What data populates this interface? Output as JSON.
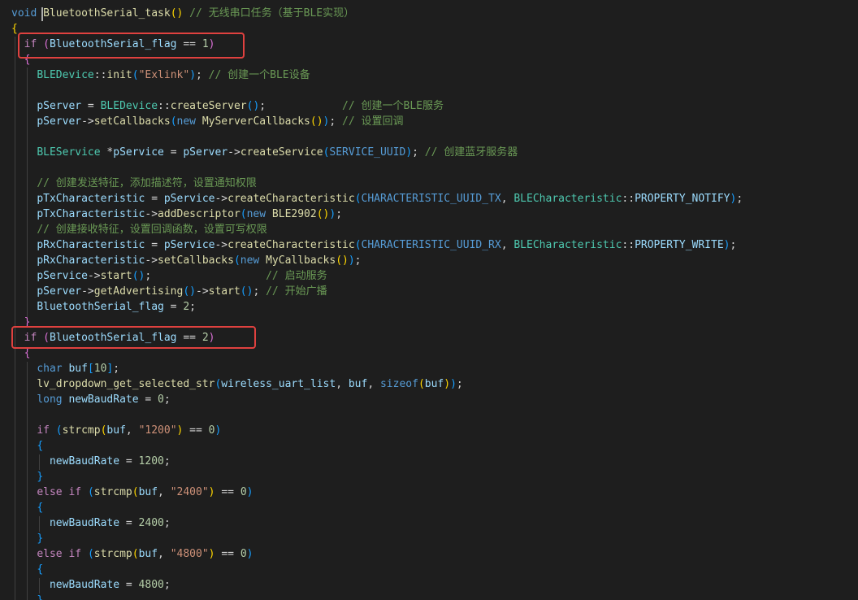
{
  "editor": {
    "lines": [
      [
        {
          "t": "void",
          "c": "kw"
        },
        {
          "t": " ",
          "c": "pl"
        },
        {
          "t": "BluetoothSerial_task",
          "c": "fn"
        },
        {
          "t": "()",
          "c": "br1"
        },
        {
          "t": " // 无线串口任务（基于BLE实现）",
          "c": "cm"
        }
      ],
      [
        {
          "t": "{",
          "c": "br1"
        }
      ],
      [
        {
          "t": "  ",
          "c": "pl"
        },
        {
          "t": "if",
          "c": "ctl"
        },
        {
          "t": " ",
          "c": "pl"
        },
        {
          "t": "(",
          "c": "br2"
        },
        {
          "t": "BluetoothSerial_flag",
          "c": "var"
        },
        {
          "t": " == ",
          "c": "pl"
        },
        {
          "t": "1",
          "c": "num"
        },
        {
          "t": ")",
          "c": "br2"
        }
      ],
      [
        {
          "t": "  ",
          "c": "pl"
        },
        {
          "t": "{",
          "c": "br2"
        }
      ],
      [
        {
          "t": "    ",
          "c": "pl"
        },
        {
          "t": "BLEDevice",
          "c": "ty"
        },
        {
          "t": "::",
          "c": "pl"
        },
        {
          "t": "init",
          "c": "fn"
        },
        {
          "t": "(",
          "c": "br3"
        },
        {
          "t": "\"Exlink\"",
          "c": "str"
        },
        {
          "t": ")",
          "c": "br3"
        },
        {
          "t": "; ",
          "c": "pl"
        },
        {
          "t": "// 创建一个BLE设备",
          "c": "cm"
        }
      ],
      [],
      [
        {
          "t": "    ",
          "c": "pl"
        },
        {
          "t": "pServer",
          "c": "var"
        },
        {
          "t": " = ",
          "c": "pl"
        },
        {
          "t": "BLEDevice",
          "c": "ty"
        },
        {
          "t": "::",
          "c": "pl"
        },
        {
          "t": "createServer",
          "c": "fn"
        },
        {
          "t": "()",
          "c": "br3"
        },
        {
          "t": ";            ",
          "c": "pl"
        },
        {
          "t": "// 创建一个BLE服务",
          "c": "cm"
        }
      ],
      [
        {
          "t": "    ",
          "c": "pl"
        },
        {
          "t": "pServer",
          "c": "var"
        },
        {
          "t": "->",
          "c": "pl"
        },
        {
          "t": "setCallbacks",
          "c": "fn"
        },
        {
          "t": "(",
          "c": "br3"
        },
        {
          "t": "new",
          "c": "kw"
        },
        {
          "t": " ",
          "c": "pl"
        },
        {
          "t": "MyServerCallbacks",
          "c": "fn"
        },
        {
          "t": "()",
          "c": "br1"
        },
        {
          "t": ")",
          "c": "br3"
        },
        {
          "t": "; ",
          "c": "pl"
        },
        {
          "t": "// 设置回调",
          "c": "cm"
        }
      ],
      [],
      [
        {
          "t": "    ",
          "c": "pl"
        },
        {
          "t": "BLEService",
          "c": "ty"
        },
        {
          "t": " *",
          "c": "pl"
        },
        {
          "t": "pService",
          "c": "var"
        },
        {
          "t": " = ",
          "c": "pl"
        },
        {
          "t": "pServer",
          "c": "var"
        },
        {
          "t": "->",
          "c": "pl"
        },
        {
          "t": "createService",
          "c": "fn"
        },
        {
          "t": "(",
          "c": "br3"
        },
        {
          "t": "SERVICE_UUID",
          "c": "ct"
        },
        {
          "t": ")",
          "c": "br3"
        },
        {
          "t": "; ",
          "c": "pl"
        },
        {
          "t": "// 创建蓝牙服务器",
          "c": "cm"
        }
      ],
      [],
      [
        {
          "t": "    ",
          "c": "pl"
        },
        {
          "t": "// 创建发送特征，添加描述符，设置通知权限",
          "c": "cm"
        }
      ],
      [
        {
          "t": "    ",
          "c": "pl"
        },
        {
          "t": "pTxCharacteristic",
          "c": "var"
        },
        {
          "t": " = ",
          "c": "pl"
        },
        {
          "t": "pService",
          "c": "var"
        },
        {
          "t": "->",
          "c": "pl"
        },
        {
          "t": "createCharacteristic",
          "c": "fn"
        },
        {
          "t": "(",
          "c": "br3"
        },
        {
          "t": "CHARACTERISTIC_UUID_TX",
          "c": "ct"
        },
        {
          "t": ", ",
          "c": "pl"
        },
        {
          "t": "BLECharacteristic",
          "c": "ty"
        },
        {
          "t": "::",
          "c": "pl"
        },
        {
          "t": "PROPERTY_NOTIFY",
          "c": "var"
        },
        {
          "t": ")",
          "c": "br3"
        },
        {
          "t": ";",
          "c": "pl"
        }
      ],
      [
        {
          "t": "    ",
          "c": "pl"
        },
        {
          "t": "pTxCharacteristic",
          "c": "var"
        },
        {
          "t": "->",
          "c": "pl"
        },
        {
          "t": "addDescriptor",
          "c": "fn"
        },
        {
          "t": "(",
          "c": "br3"
        },
        {
          "t": "new",
          "c": "kw"
        },
        {
          "t": " ",
          "c": "pl"
        },
        {
          "t": "BLE2902",
          "c": "fn"
        },
        {
          "t": "()",
          "c": "br1"
        },
        {
          "t": ")",
          "c": "br3"
        },
        {
          "t": ";",
          "c": "pl"
        }
      ],
      [
        {
          "t": "    ",
          "c": "pl"
        },
        {
          "t": "// 创建接收特征，设置回调函数，设置可写权限",
          "c": "cm"
        }
      ],
      [
        {
          "t": "    ",
          "c": "pl"
        },
        {
          "t": "pRxCharacteristic",
          "c": "var"
        },
        {
          "t": " = ",
          "c": "pl"
        },
        {
          "t": "pService",
          "c": "var"
        },
        {
          "t": "->",
          "c": "pl"
        },
        {
          "t": "createCharacteristic",
          "c": "fn"
        },
        {
          "t": "(",
          "c": "br3"
        },
        {
          "t": "CHARACTERISTIC_UUID_RX",
          "c": "ct"
        },
        {
          "t": ", ",
          "c": "pl"
        },
        {
          "t": "BLECharacteristic",
          "c": "ty"
        },
        {
          "t": "::",
          "c": "pl"
        },
        {
          "t": "PROPERTY_WRITE",
          "c": "var"
        },
        {
          "t": ")",
          "c": "br3"
        },
        {
          "t": ";",
          "c": "pl"
        }
      ],
      [
        {
          "t": "    ",
          "c": "pl"
        },
        {
          "t": "pRxCharacteristic",
          "c": "var"
        },
        {
          "t": "->",
          "c": "pl"
        },
        {
          "t": "setCallbacks",
          "c": "fn"
        },
        {
          "t": "(",
          "c": "br3"
        },
        {
          "t": "new",
          "c": "kw"
        },
        {
          "t": " ",
          "c": "pl"
        },
        {
          "t": "MyCallbacks",
          "c": "fn"
        },
        {
          "t": "()",
          "c": "br1"
        },
        {
          "t": ")",
          "c": "br3"
        },
        {
          "t": ";",
          "c": "pl"
        }
      ],
      [
        {
          "t": "    ",
          "c": "pl"
        },
        {
          "t": "pService",
          "c": "var"
        },
        {
          "t": "->",
          "c": "pl"
        },
        {
          "t": "start",
          "c": "fn"
        },
        {
          "t": "()",
          "c": "br3"
        },
        {
          "t": ";                  ",
          "c": "pl"
        },
        {
          "t": "// 启动服务",
          "c": "cm"
        }
      ],
      [
        {
          "t": "    ",
          "c": "pl"
        },
        {
          "t": "pServer",
          "c": "var"
        },
        {
          "t": "->",
          "c": "pl"
        },
        {
          "t": "getAdvertising",
          "c": "fn"
        },
        {
          "t": "()",
          "c": "br3"
        },
        {
          "t": "->",
          "c": "pl"
        },
        {
          "t": "start",
          "c": "fn"
        },
        {
          "t": "()",
          "c": "br3"
        },
        {
          "t": "; ",
          "c": "pl"
        },
        {
          "t": "// 开始广播",
          "c": "cm"
        }
      ],
      [
        {
          "t": "    ",
          "c": "pl"
        },
        {
          "t": "BluetoothSerial_flag",
          "c": "var"
        },
        {
          "t": " = ",
          "c": "pl"
        },
        {
          "t": "2",
          "c": "num"
        },
        {
          "t": ";",
          "c": "pl"
        }
      ],
      [
        {
          "t": "  ",
          "c": "pl"
        },
        {
          "t": "}",
          "c": "br2"
        }
      ],
      [
        {
          "t": "  ",
          "c": "pl"
        },
        {
          "t": "if",
          "c": "ctl"
        },
        {
          "t": " ",
          "c": "pl"
        },
        {
          "t": "(",
          "c": "br2"
        },
        {
          "t": "BluetoothSerial_flag",
          "c": "var"
        },
        {
          "t": " == ",
          "c": "pl"
        },
        {
          "t": "2",
          "c": "num"
        },
        {
          "t": ")",
          "c": "br2"
        }
      ],
      [
        {
          "t": "  ",
          "c": "pl"
        },
        {
          "t": "{",
          "c": "br2"
        }
      ],
      [
        {
          "t": "    ",
          "c": "pl"
        },
        {
          "t": "char",
          "c": "kw"
        },
        {
          "t": " ",
          "c": "pl"
        },
        {
          "t": "buf",
          "c": "var"
        },
        {
          "t": "[",
          "c": "br3"
        },
        {
          "t": "10",
          "c": "num"
        },
        {
          "t": "]",
          "c": "br3"
        },
        {
          "t": ";",
          "c": "pl"
        }
      ],
      [
        {
          "t": "    ",
          "c": "pl"
        },
        {
          "t": "lv_dropdown_get_selected_str",
          "c": "fn"
        },
        {
          "t": "(",
          "c": "br3"
        },
        {
          "t": "wireless_uart_list",
          "c": "var"
        },
        {
          "t": ", ",
          "c": "pl"
        },
        {
          "t": "buf",
          "c": "var"
        },
        {
          "t": ", ",
          "c": "pl"
        },
        {
          "t": "sizeof",
          "c": "kw"
        },
        {
          "t": "(",
          "c": "br1"
        },
        {
          "t": "buf",
          "c": "var"
        },
        {
          "t": ")",
          "c": "br1"
        },
        {
          "t": ")",
          "c": "br3"
        },
        {
          "t": ";",
          "c": "pl"
        }
      ],
      [
        {
          "t": "    ",
          "c": "pl"
        },
        {
          "t": "long",
          "c": "kw"
        },
        {
          "t": " ",
          "c": "pl"
        },
        {
          "t": "newBaudRate",
          "c": "var"
        },
        {
          "t": " = ",
          "c": "pl"
        },
        {
          "t": "0",
          "c": "num"
        },
        {
          "t": ";",
          "c": "pl"
        }
      ],
      [],
      [
        {
          "t": "    ",
          "c": "pl"
        },
        {
          "t": "if",
          "c": "ctl"
        },
        {
          "t": " ",
          "c": "pl"
        },
        {
          "t": "(",
          "c": "br3"
        },
        {
          "t": "strcmp",
          "c": "fn"
        },
        {
          "t": "(",
          "c": "br1"
        },
        {
          "t": "buf",
          "c": "var"
        },
        {
          "t": ", ",
          "c": "pl"
        },
        {
          "t": "\"1200\"",
          "c": "str"
        },
        {
          "t": ")",
          "c": "br1"
        },
        {
          "t": " == ",
          "c": "pl"
        },
        {
          "t": "0",
          "c": "num"
        },
        {
          "t": ")",
          "c": "br3"
        }
      ],
      [
        {
          "t": "    ",
          "c": "pl"
        },
        {
          "t": "{",
          "c": "br3"
        }
      ],
      [
        {
          "t": "      ",
          "c": "pl"
        },
        {
          "t": "newBaudRate",
          "c": "var"
        },
        {
          "t": " = ",
          "c": "pl"
        },
        {
          "t": "1200",
          "c": "num"
        },
        {
          "t": ";",
          "c": "pl"
        }
      ],
      [
        {
          "t": "    ",
          "c": "pl"
        },
        {
          "t": "}",
          "c": "br3"
        }
      ],
      [
        {
          "t": "    ",
          "c": "pl"
        },
        {
          "t": "else",
          "c": "ctl"
        },
        {
          "t": " ",
          "c": "pl"
        },
        {
          "t": "if",
          "c": "ctl"
        },
        {
          "t": " ",
          "c": "pl"
        },
        {
          "t": "(",
          "c": "br3"
        },
        {
          "t": "strcmp",
          "c": "fn"
        },
        {
          "t": "(",
          "c": "br1"
        },
        {
          "t": "buf",
          "c": "var"
        },
        {
          "t": ", ",
          "c": "pl"
        },
        {
          "t": "\"2400\"",
          "c": "str"
        },
        {
          "t": ")",
          "c": "br1"
        },
        {
          "t": " == ",
          "c": "pl"
        },
        {
          "t": "0",
          "c": "num"
        },
        {
          "t": ")",
          "c": "br3"
        }
      ],
      [
        {
          "t": "    ",
          "c": "pl"
        },
        {
          "t": "{",
          "c": "br3"
        }
      ],
      [
        {
          "t": "      ",
          "c": "pl"
        },
        {
          "t": "newBaudRate",
          "c": "var"
        },
        {
          "t": " = ",
          "c": "pl"
        },
        {
          "t": "2400",
          "c": "num"
        },
        {
          "t": ";",
          "c": "pl"
        }
      ],
      [
        {
          "t": "    ",
          "c": "pl"
        },
        {
          "t": "}",
          "c": "br3"
        }
      ],
      [
        {
          "t": "    ",
          "c": "pl"
        },
        {
          "t": "else",
          "c": "ctl"
        },
        {
          "t": " ",
          "c": "pl"
        },
        {
          "t": "if",
          "c": "ctl"
        },
        {
          "t": " ",
          "c": "pl"
        },
        {
          "t": "(",
          "c": "br3"
        },
        {
          "t": "strcmp",
          "c": "fn"
        },
        {
          "t": "(",
          "c": "br1"
        },
        {
          "t": "buf",
          "c": "var"
        },
        {
          "t": ", ",
          "c": "pl"
        },
        {
          "t": "\"4800\"",
          "c": "str"
        },
        {
          "t": ")",
          "c": "br1"
        },
        {
          "t": " == ",
          "c": "pl"
        },
        {
          "t": "0",
          "c": "num"
        },
        {
          "t": ")",
          "c": "br3"
        }
      ],
      [
        {
          "t": "    ",
          "c": "pl"
        },
        {
          "t": "{",
          "c": "br3"
        }
      ],
      [
        {
          "t": "      ",
          "c": "pl"
        },
        {
          "t": "newBaudRate",
          "c": "var"
        },
        {
          "t": " = ",
          "c": "pl"
        },
        {
          "t": "4800",
          "c": "num"
        },
        {
          "t": ";",
          "c": "pl"
        }
      ],
      [
        {
          "t": "    ",
          "c": "pl"
        },
        {
          "t": "}",
          "c": "br3"
        }
      ]
    ]
  }
}
